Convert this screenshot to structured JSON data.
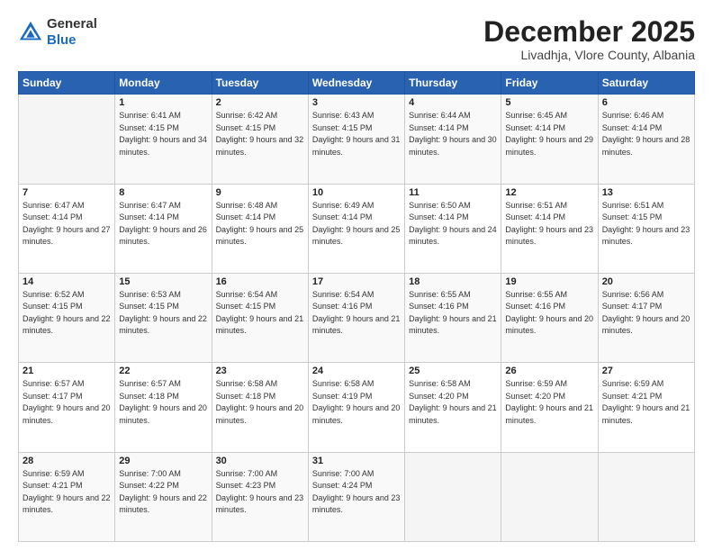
{
  "header": {
    "logo_general": "General",
    "logo_blue": "Blue",
    "month": "December 2025",
    "location": "Livadhja, Vlore County, Albania"
  },
  "weekdays": [
    "Sunday",
    "Monday",
    "Tuesday",
    "Wednesday",
    "Thursday",
    "Friday",
    "Saturday"
  ],
  "weeks": [
    [
      {
        "day": "",
        "sunrise": "",
        "sunset": "",
        "daylight": ""
      },
      {
        "day": "1",
        "sunrise": "6:41 AM",
        "sunset": "4:15 PM",
        "daylight": "9 hours and 34 minutes."
      },
      {
        "day": "2",
        "sunrise": "6:42 AM",
        "sunset": "4:15 PM",
        "daylight": "9 hours and 32 minutes."
      },
      {
        "day": "3",
        "sunrise": "6:43 AM",
        "sunset": "4:15 PM",
        "daylight": "9 hours and 31 minutes."
      },
      {
        "day": "4",
        "sunrise": "6:44 AM",
        "sunset": "4:14 PM",
        "daylight": "9 hours and 30 minutes."
      },
      {
        "day": "5",
        "sunrise": "6:45 AM",
        "sunset": "4:14 PM",
        "daylight": "9 hours and 29 minutes."
      },
      {
        "day": "6",
        "sunrise": "6:46 AM",
        "sunset": "4:14 PM",
        "daylight": "9 hours and 28 minutes."
      }
    ],
    [
      {
        "day": "7",
        "sunrise": "6:47 AM",
        "sunset": "4:14 PM",
        "daylight": "9 hours and 27 minutes."
      },
      {
        "day": "8",
        "sunrise": "6:47 AM",
        "sunset": "4:14 PM",
        "daylight": "9 hours and 26 minutes."
      },
      {
        "day": "9",
        "sunrise": "6:48 AM",
        "sunset": "4:14 PM",
        "daylight": "9 hours and 25 minutes."
      },
      {
        "day": "10",
        "sunrise": "6:49 AM",
        "sunset": "4:14 PM",
        "daylight": "9 hours and 25 minutes."
      },
      {
        "day": "11",
        "sunrise": "6:50 AM",
        "sunset": "4:14 PM",
        "daylight": "9 hours and 24 minutes."
      },
      {
        "day": "12",
        "sunrise": "6:51 AM",
        "sunset": "4:14 PM",
        "daylight": "9 hours and 23 minutes."
      },
      {
        "day": "13",
        "sunrise": "6:51 AM",
        "sunset": "4:15 PM",
        "daylight": "9 hours and 23 minutes."
      }
    ],
    [
      {
        "day": "14",
        "sunrise": "6:52 AM",
        "sunset": "4:15 PM",
        "daylight": "9 hours and 22 minutes."
      },
      {
        "day": "15",
        "sunrise": "6:53 AM",
        "sunset": "4:15 PM",
        "daylight": "9 hours and 22 minutes."
      },
      {
        "day": "16",
        "sunrise": "6:54 AM",
        "sunset": "4:15 PM",
        "daylight": "9 hours and 21 minutes."
      },
      {
        "day": "17",
        "sunrise": "6:54 AM",
        "sunset": "4:16 PM",
        "daylight": "9 hours and 21 minutes."
      },
      {
        "day": "18",
        "sunrise": "6:55 AM",
        "sunset": "4:16 PM",
        "daylight": "9 hours and 21 minutes."
      },
      {
        "day": "19",
        "sunrise": "6:55 AM",
        "sunset": "4:16 PM",
        "daylight": "9 hours and 20 minutes."
      },
      {
        "day": "20",
        "sunrise": "6:56 AM",
        "sunset": "4:17 PM",
        "daylight": "9 hours and 20 minutes."
      }
    ],
    [
      {
        "day": "21",
        "sunrise": "6:57 AM",
        "sunset": "4:17 PM",
        "daylight": "9 hours and 20 minutes."
      },
      {
        "day": "22",
        "sunrise": "6:57 AM",
        "sunset": "4:18 PM",
        "daylight": "9 hours and 20 minutes."
      },
      {
        "day": "23",
        "sunrise": "6:58 AM",
        "sunset": "4:18 PM",
        "daylight": "9 hours and 20 minutes."
      },
      {
        "day": "24",
        "sunrise": "6:58 AM",
        "sunset": "4:19 PM",
        "daylight": "9 hours and 20 minutes."
      },
      {
        "day": "25",
        "sunrise": "6:58 AM",
        "sunset": "4:20 PM",
        "daylight": "9 hours and 21 minutes."
      },
      {
        "day": "26",
        "sunrise": "6:59 AM",
        "sunset": "4:20 PM",
        "daylight": "9 hours and 21 minutes."
      },
      {
        "day": "27",
        "sunrise": "6:59 AM",
        "sunset": "4:21 PM",
        "daylight": "9 hours and 21 minutes."
      }
    ],
    [
      {
        "day": "28",
        "sunrise": "6:59 AM",
        "sunset": "4:21 PM",
        "daylight": "9 hours and 22 minutes."
      },
      {
        "day": "29",
        "sunrise": "7:00 AM",
        "sunset": "4:22 PM",
        "daylight": "9 hours and 22 minutes."
      },
      {
        "day": "30",
        "sunrise": "7:00 AM",
        "sunset": "4:23 PM",
        "daylight": "9 hours and 23 minutes."
      },
      {
        "day": "31",
        "sunrise": "7:00 AM",
        "sunset": "4:24 PM",
        "daylight": "9 hours and 23 minutes."
      },
      {
        "day": "",
        "sunrise": "",
        "sunset": "",
        "daylight": ""
      },
      {
        "day": "",
        "sunrise": "",
        "sunset": "",
        "daylight": ""
      },
      {
        "day": "",
        "sunrise": "",
        "sunset": "",
        "daylight": ""
      }
    ]
  ]
}
